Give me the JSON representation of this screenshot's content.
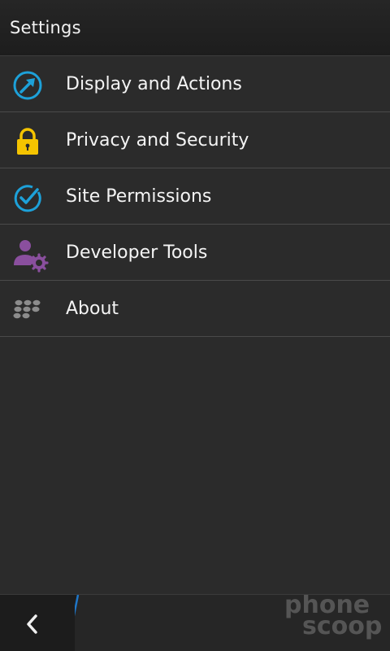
{
  "header": {
    "title": "Settings"
  },
  "items": [
    {
      "label": "Display and Actions",
      "icon": "display-actions-icon",
      "color": "#1da1d9"
    },
    {
      "label": "Privacy and Security",
      "icon": "lock-icon",
      "color": "#f5c400"
    },
    {
      "label": "Site Permissions",
      "icon": "checkmark-circle-icon",
      "color": "#1da1d9"
    },
    {
      "label": "Developer Tools",
      "icon": "developer-gear-icon",
      "color": "#8a4f9e"
    },
    {
      "label": "About",
      "icon": "blackberry-logo-icon",
      "color": "#8c8c8c"
    }
  ],
  "action_bar": {
    "back_icon": "chevron-left-icon",
    "accent": "#1f76c7"
  },
  "watermark": {
    "word1": "phone",
    "word2": "scoop"
  }
}
